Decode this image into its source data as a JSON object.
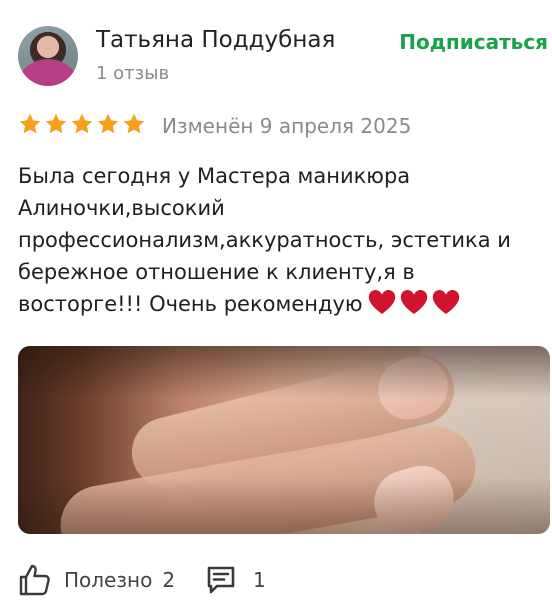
{
  "author": {
    "name": "Татьяна Поддубная",
    "meta": "1 отзыв",
    "subscribe_label": "Подписаться"
  },
  "rating": {
    "stars": 5,
    "max": 5,
    "edited": "Изменён 9 апреля 2025"
  },
  "review": {
    "lines": [
      "Была сегодня у Мастера маникюра",
      "Алиночки,высокий",
      "профессионализм,аккуратность, эстетика и",
      "бережное отношение к клиенту,я в",
      "восторге!!! Очень рекомендую"
    ],
    "emoji": [
      "heart-icon",
      "heart-icon",
      "heart-icon"
    ]
  },
  "footer": {
    "useful_label": "Полезно",
    "useful_count": "2",
    "comments_count": "1"
  },
  "colors": {
    "accent_green": "#19a24a",
    "star_orange": "#f5a01a",
    "heart_red": "#d1142b",
    "muted_text": "#8a8a8a"
  }
}
